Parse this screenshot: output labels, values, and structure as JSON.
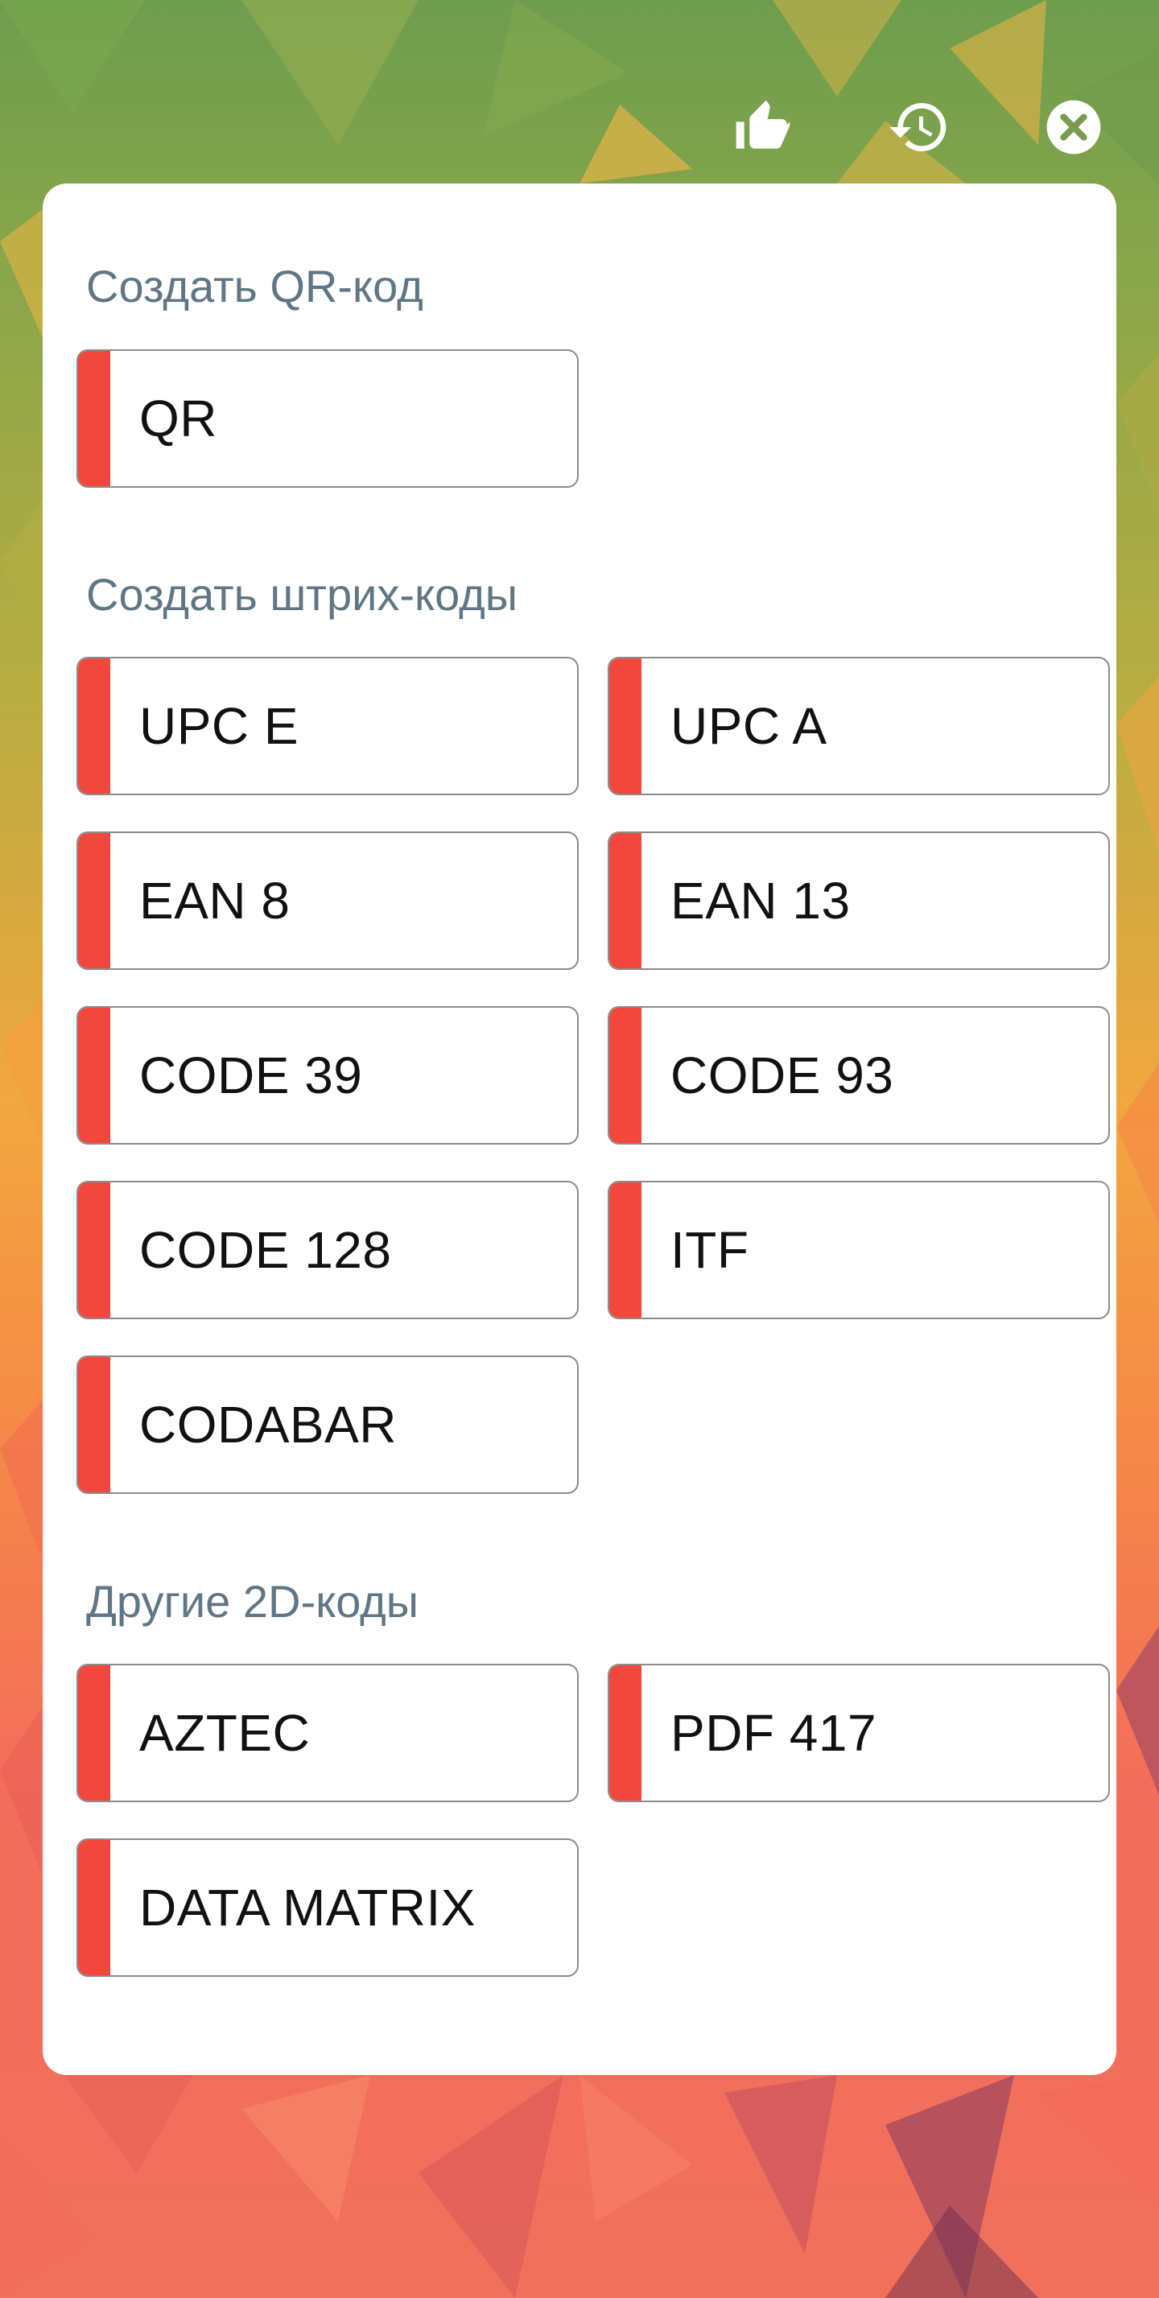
{
  "header": {
    "actions": [
      {
        "name": "like-icon"
      },
      {
        "name": "history-icon"
      },
      {
        "name": "close-icon"
      }
    ]
  },
  "sections": [
    {
      "title": "Создать QR-код",
      "buttons": [
        "QR"
      ]
    },
    {
      "title": "Создать штрих-коды",
      "buttons": [
        "UPC E",
        "UPC A",
        "EAN 8",
        "EAN 13",
        "CODE 39",
        "CODE 93",
        "CODE 128",
        "ITF",
        "CODABAR"
      ]
    },
    {
      "title": "Другие 2D-коды",
      "buttons": [
        "AZTEC",
        "PDF 417",
        "DATA MATRIX"
      ]
    }
  ],
  "colors": {
    "accent": "#f2473d",
    "section_title": "#5f7684",
    "card": "#ffffff"
  }
}
